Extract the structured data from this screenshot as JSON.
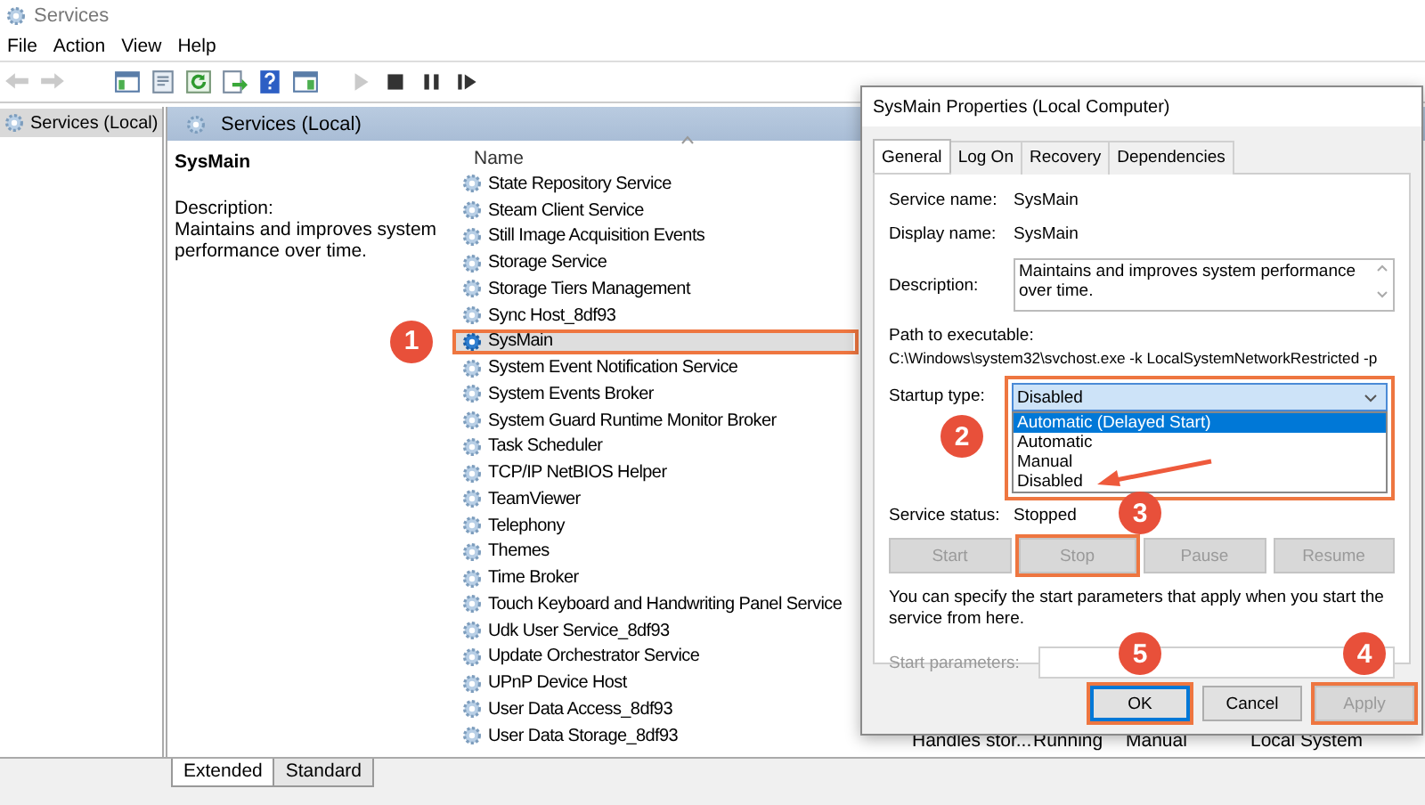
{
  "window": {
    "title": "Services"
  },
  "menu": [
    "File",
    "Action",
    "View",
    "Help"
  ],
  "toolbar": [
    {
      "kind": "back",
      "disabled": true
    },
    {
      "kind": "forward",
      "disabled": true
    },
    {
      "kind": "console-tree",
      "disabled": false
    },
    {
      "kind": "properties",
      "disabled": false
    },
    {
      "kind": "refresh",
      "disabled": false
    },
    {
      "kind": "export",
      "disabled": false
    },
    {
      "kind": "help",
      "disabled": false
    },
    {
      "kind": "show-pane",
      "disabled": false
    },
    {
      "kind": "start",
      "disabled": true
    },
    {
      "kind": "stop",
      "disabled": false
    },
    {
      "kind": "pause",
      "disabled": false
    },
    {
      "kind": "resume",
      "disabled": false
    }
  ],
  "tree": {
    "items": [
      {
        "label": "Services (Local)",
        "selected": true
      }
    ]
  },
  "panel": {
    "title": "Services (Local)",
    "details": {
      "name": "SysMain",
      "description_label": "Description:",
      "description": "Maintains and improves system performance over time."
    },
    "list": {
      "columns": [
        "Name"
      ],
      "rows": [
        {
          "name": "State Repository Service",
          "selected": false
        },
        {
          "name": "Steam Client Service",
          "selected": false
        },
        {
          "name": "Still Image Acquisition Events",
          "selected": false
        },
        {
          "name": "Storage Service",
          "selected": false
        },
        {
          "name": "Storage Tiers Management",
          "selected": false
        },
        {
          "name": "Sync Host_8df93",
          "selected": false
        },
        {
          "name": "SysMain",
          "selected": true,
          "step": "1"
        },
        {
          "name": "System Event Notification Service",
          "selected": false
        },
        {
          "name": "System Events Broker",
          "selected": false
        },
        {
          "name": "System Guard Runtime Monitor Broker",
          "selected": false
        },
        {
          "name": "Task Scheduler",
          "selected": false
        },
        {
          "name": "TCP/IP NetBIOS Helper",
          "selected": false
        },
        {
          "name": "TeamViewer",
          "selected": false
        },
        {
          "name": "Telephony",
          "selected": false
        },
        {
          "name": "Themes",
          "selected": false
        },
        {
          "name": "Time Broker",
          "selected": false
        },
        {
          "name": "Touch Keyboard and Handwriting Panel Service",
          "selected": false
        },
        {
          "name": "Udk User Service_8df93",
          "selected": false
        },
        {
          "name": "Update Orchestrator Service",
          "selected": false
        },
        {
          "name": "UPnP Device Host",
          "selected": false
        },
        {
          "name": "User Data Access_8df93",
          "selected": false
        },
        {
          "name": "User Data Storage_8df93",
          "selected": false,
          "column_2": "Handles stor...",
          "column_3": "Running",
          "column_4": "Manual",
          "column_5": "Local System"
        }
      ]
    }
  },
  "view_tabs": [
    {
      "label": "Extended",
      "selected": true
    },
    {
      "label": "Standard",
      "selected": false
    }
  ],
  "dialog": {
    "title": "SysMain Properties (Local Computer)",
    "tabs": [
      {
        "label": "General",
        "selected": true
      },
      {
        "label": "Log On",
        "selected": false
      },
      {
        "label": "Recovery",
        "selected": false
      },
      {
        "label": "Dependencies",
        "selected": false
      }
    ],
    "service_name": {
      "label": "Service name:",
      "value": "SysMain"
    },
    "display_name": {
      "label": "Display name:",
      "value": "SysMain"
    },
    "description": {
      "label": "Description:",
      "value": "Maintains and improves system performance over time."
    },
    "path": {
      "label": "Path to executable:",
      "value": "C:\\Windows\\system32\\svchost.exe -k LocalSystemNetworkRestricted -p"
    },
    "startup_type": {
      "label": "Startup type:",
      "value": "Disabled",
      "step": "2",
      "options": [
        {
          "label": "Automatic (Delayed Start)",
          "highlighted": true,
          "arrow": false
        },
        {
          "label": "Automatic",
          "highlighted": false,
          "arrow": false
        },
        {
          "label": "Manual",
          "highlighted": false,
          "arrow": false
        },
        {
          "label": "Disabled",
          "highlighted": false,
          "arrow": true
        }
      ]
    },
    "service_status": {
      "label": "Service status:",
      "value": "Stopped"
    },
    "service_buttons": [
      {
        "label": "Start",
        "disabled": true
      },
      {
        "label": "Stop",
        "disabled": true,
        "step": "3"
      },
      {
        "label": "Pause",
        "disabled": true
      },
      {
        "label": "Resume",
        "disabled": true
      }
    ],
    "hint": "You can specify the start parameters that apply when you start the service from here.",
    "start_parameters": {
      "label": "Start parameters:",
      "disabled": true
    },
    "buttons": [
      {
        "label": "OK",
        "default": true,
        "disabled": false,
        "step": "5"
      },
      {
        "label": "Cancel",
        "default": false,
        "disabled": false
      },
      {
        "label": "Apply",
        "default": false,
        "disabled": true,
        "step": "4"
      }
    ]
  }
}
